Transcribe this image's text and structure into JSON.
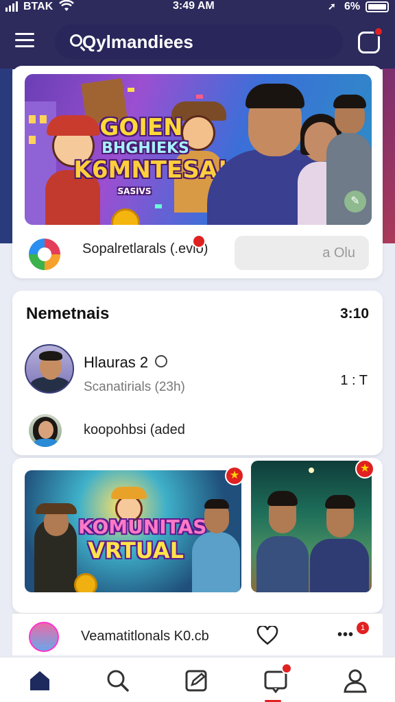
{
  "status_bar": {
    "carrier": "BTAK",
    "time": "3:49 AM",
    "battery": "6%"
  },
  "header": {
    "search_text": "Qylmandiees"
  },
  "promo_card": {
    "banner_title_1": "GOIEN",
    "banner_title_2": "BHGHIEKS",
    "banner_title_3": "K6MNTESA!",
    "banner_title_4": "SASIVS",
    "text": "Sopalretlarals (.evlo)",
    "button_label": "a Olu"
  },
  "members": {
    "title": "Nemetnais",
    "count": "3:10",
    "rows": [
      {
        "name": "Hlauras 2",
        "sub": "Scanatirials  (23h)",
        "time": "1 : T"
      },
      {
        "name": "koopohbsi  (aded"
      }
    ]
  },
  "media": {
    "thumb1_text_1": "KOMUNITAS",
    "thumb1_text_2": "VRTUAL"
  },
  "mini_bar": {
    "text": "Veamatitlonals  K0.cb",
    "badge": "1"
  },
  "icons": {
    "menu": "menu-icon",
    "search": "search-icon",
    "notification": "bell-icon",
    "home": "home-icon",
    "edit": "edit-icon",
    "messages": "chat-icon",
    "profile": "user-icon",
    "heart": "heart-icon",
    "more": "more-icon"
  },
  "colors": {
    "header_bg": "#2d2a5c",
    "accent_red": "#e02121",
    "nav_active": "#1e2a5e"
  }
}
